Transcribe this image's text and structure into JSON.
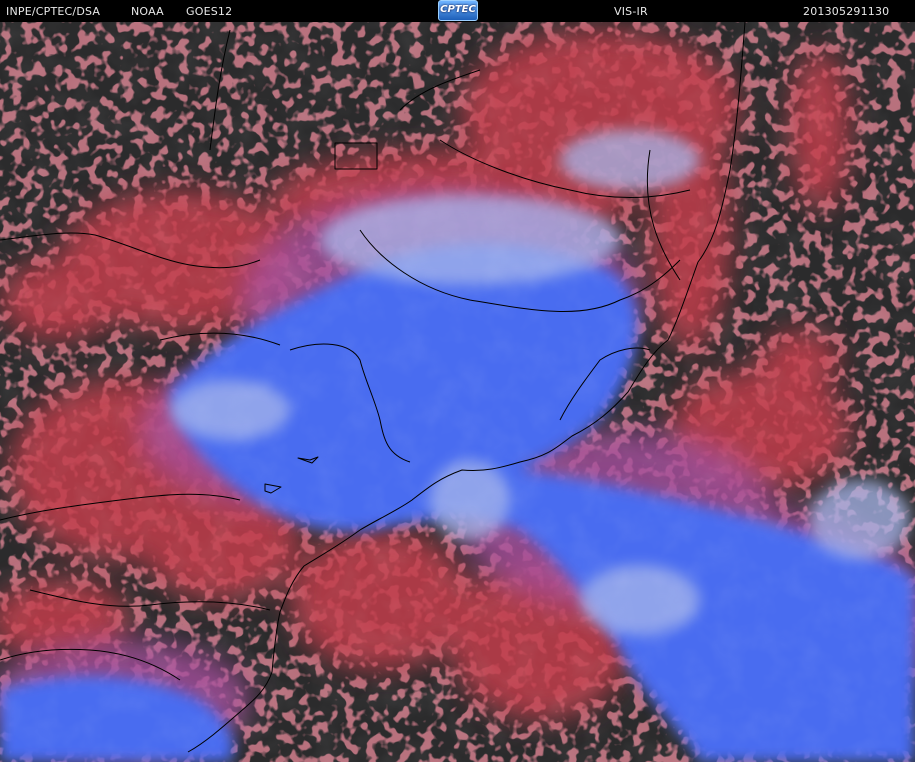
{
  "header": {
    "source": "INPE/CPTEC/DSA",
    "agency": "NOAA",
    "satellite": "GOES12",
    "product": "VIS-IR",
    "timestamp": "201305291130",
    "logo_text": "CPTEC"
  },
  "colors": {
    "header_bg": "#000000",
    "header_text": "#e8e8e8",
    "clear_sky": "#2b2b2c",
    "low_cloud": "#c8404f",
    "high_cloud": "#4a6cf0",
    "bright_cloud": "#9ab0ee",
    "borders": "#000000"
  }
}
